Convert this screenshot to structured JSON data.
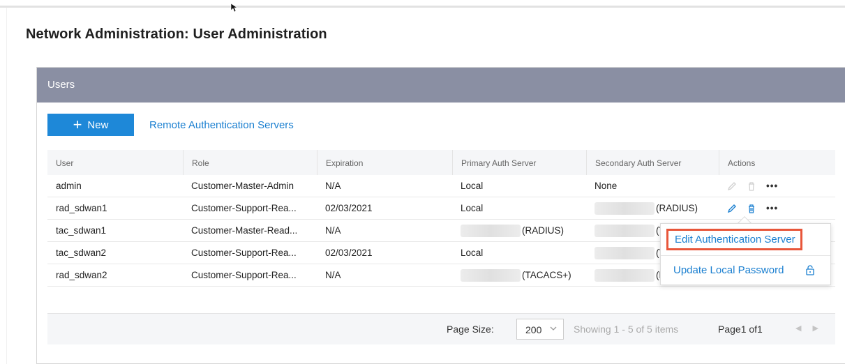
{
  "page": {
    "title": "Network Administration: User Administration"
  },
  "panel": {
    "title": "Users"
  },
  "toolbar": {
    "new_label": "New",
    "remote_auth_link": "Remote Authentication Servers"
  },
  "table": {
    "columns": [
      "User",
      "Role",
      "Expiration",
      "Primary Auth Server",
      "Secondary Auth Server",
      "Actions"
    ],
    "rows": [
      {
        "user": "admin",
        "role": "Customer-Master-Admin",
        "expiration": "N/A",
        "primary": "Local",
        "secondary": "None"
      },
      {
        "user": "rad_sdwan1",
        "role": "Customer-Support-Rea...",
        "expiration": "02/03/2021",
        "primary": "Local",
        "secondary": "(RADIUS)"
      },
      {
        "user": "tac_sdwan1",
        "role": "Customer-Master-Read...",
        "expiration": "N/A",
        "primary": "(RADIUS)",
        "secondary": "(T"
      },
      {
        "user": "tac_sdwan2",
        "role": "Customer-Support-Rea...",
        "expiration": "02/03/2021",
        "primary": "Local",
        "secondary": "(T"
      },
      {
        "user": "rad_sdwan2",
        "role": "Customer-Support-Rea...",
        "expiration": "N/A",
        "primary": "(TACACS+)",
        "secondary": "(R"
      }
    ]
  },
  "footer": {
    "page_size_label": "Page Size:",
    "page_size_value": "200",
    "showing": "Showing 1 - 5 of 5 items",
    "page_info": "Page1 of1"
  },
  "popup": {
    "edit_auth_server": "Edit Authentication Server",
    "update_local_password": "Update Local Password"
  },
  "colors": {
    "accent": "#1e88d8",
    "header_bar": "#8a8fa3",
    "highlight": "#e8563a"
  }
}
